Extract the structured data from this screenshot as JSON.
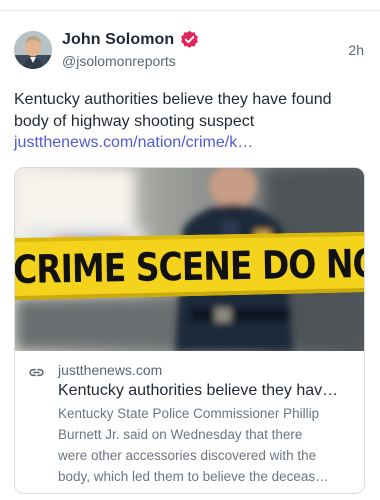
{
  "post": {
    "author": {
      "name": "John Solomon",
      "handle": "@jsolomonreports",
      "avatar_icon": "author-avatar",
      "verified_icon": "verified-badge-icon",
      "verified_color": "#e0245e"
    },
    "time": "2h",
    "text": "Kentucky authorities believe they have found body of highway shooting suspect",
    "link_text": "justthenews.com/nation/crime/k…",
    "link_color": "#4f5bd5",
    "card": {
      "image_caption": "CRIME SCENE DO NOT CRO",
      "domain_icon": "link-icon",
      "domain": "justthenews.com",
      "title": "Kentucky authorities believe they hav…",
      "description_lines": [
        "Kentucky State Police Commissioner Phillip",
        "Burnett Jr. said on Wednesday that there",
        "were other accessories discovered with the",
        "body, which led them to believe the deceas…"
      ],
      "tape_color": "#f4d31c"
    }
  }
}
